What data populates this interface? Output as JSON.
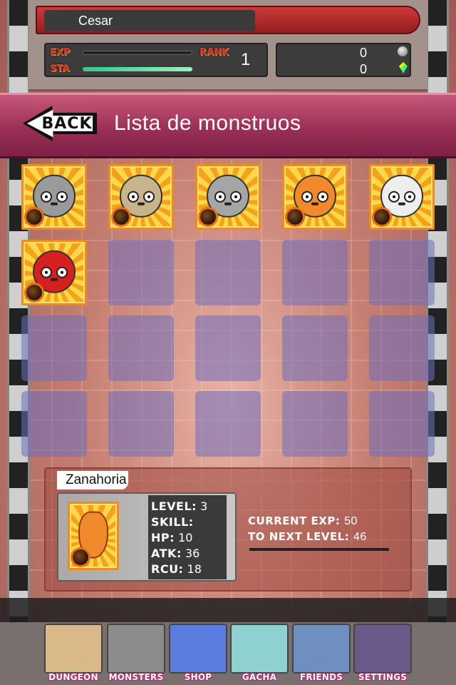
{
  "player": {
    "name": "Cesar",
    "exp_label": "EXP",
    "sta_label": "STA",
    "rank_label": "RANK",
    "rank": "1",
    "exp_progress": 0.0,
    "sta_progress": 1.0,
    "coins": "0",
    "gems": "0"
  },
  "header": {
    "back_label": "BACK",
    "title": "Lista de monstruos"
  },
  "monsters": [
    {
      "name": "stone-monster",
      "color": "#9a9a9a"
    },
    {
      "name": "onion-monster",
      "color": "#c8b48a"
    },
    {
      "name": "stone-sprout-monster",
      "color": "#a5a5a5"
    },
    {
      "name": "carrot-monster",
      "color": "#f08a2a"
    },
    {
      "name": "garlic-monster",
      "color": "#eeeeee"
    },
    {
      "name": "apple-monster",
      "color": "#d62020"
    }
  ],
  "detail": {
    "name": "Zanahoria",
    "level_label": "LEVEL:",
    "level": "3",
    "skill_label": "SKILL:",
    "skill": "",
    "hp_label": "HP:",
    "hp": "10",
    "atk_label": "ATK:",
    "atk": "36",
    "rcv_label": "RCU:",
    "rcv": "18",
    "current_exp_label": "CURRENT EXP:",
    "current_exp": "50",
    "next_level_label": "TO NEXT LEVEL:",
    "next_level": "46"
  },
  "nav": [
    {
      "label": "DUNGEON",
      "icon": "map-icon",
      "color": "#d9b98a"
    },
    {
      "label": "MONSTERS",
      "icon": "stone-monster-icon",
      "color": "#8c8c8c"
    },
    {
      "label": "SHOP",
      "icon": "gem-cluster-icon",
      "color": "#5a7de0"
    },
    {
      "label": "GACHA",
      "icon": "capsule-icon",
      "color": "#8fd0d0"
    },
    {
      "label": "FRIENDS",
      "icon": "handshake-icon",
      "color": "#6f8fc0"
    },
    {
      "label": "SETTINGS",
      "icon": "wrench-icon",
      "color": "#6a5a8a"
    }
  ]
}
